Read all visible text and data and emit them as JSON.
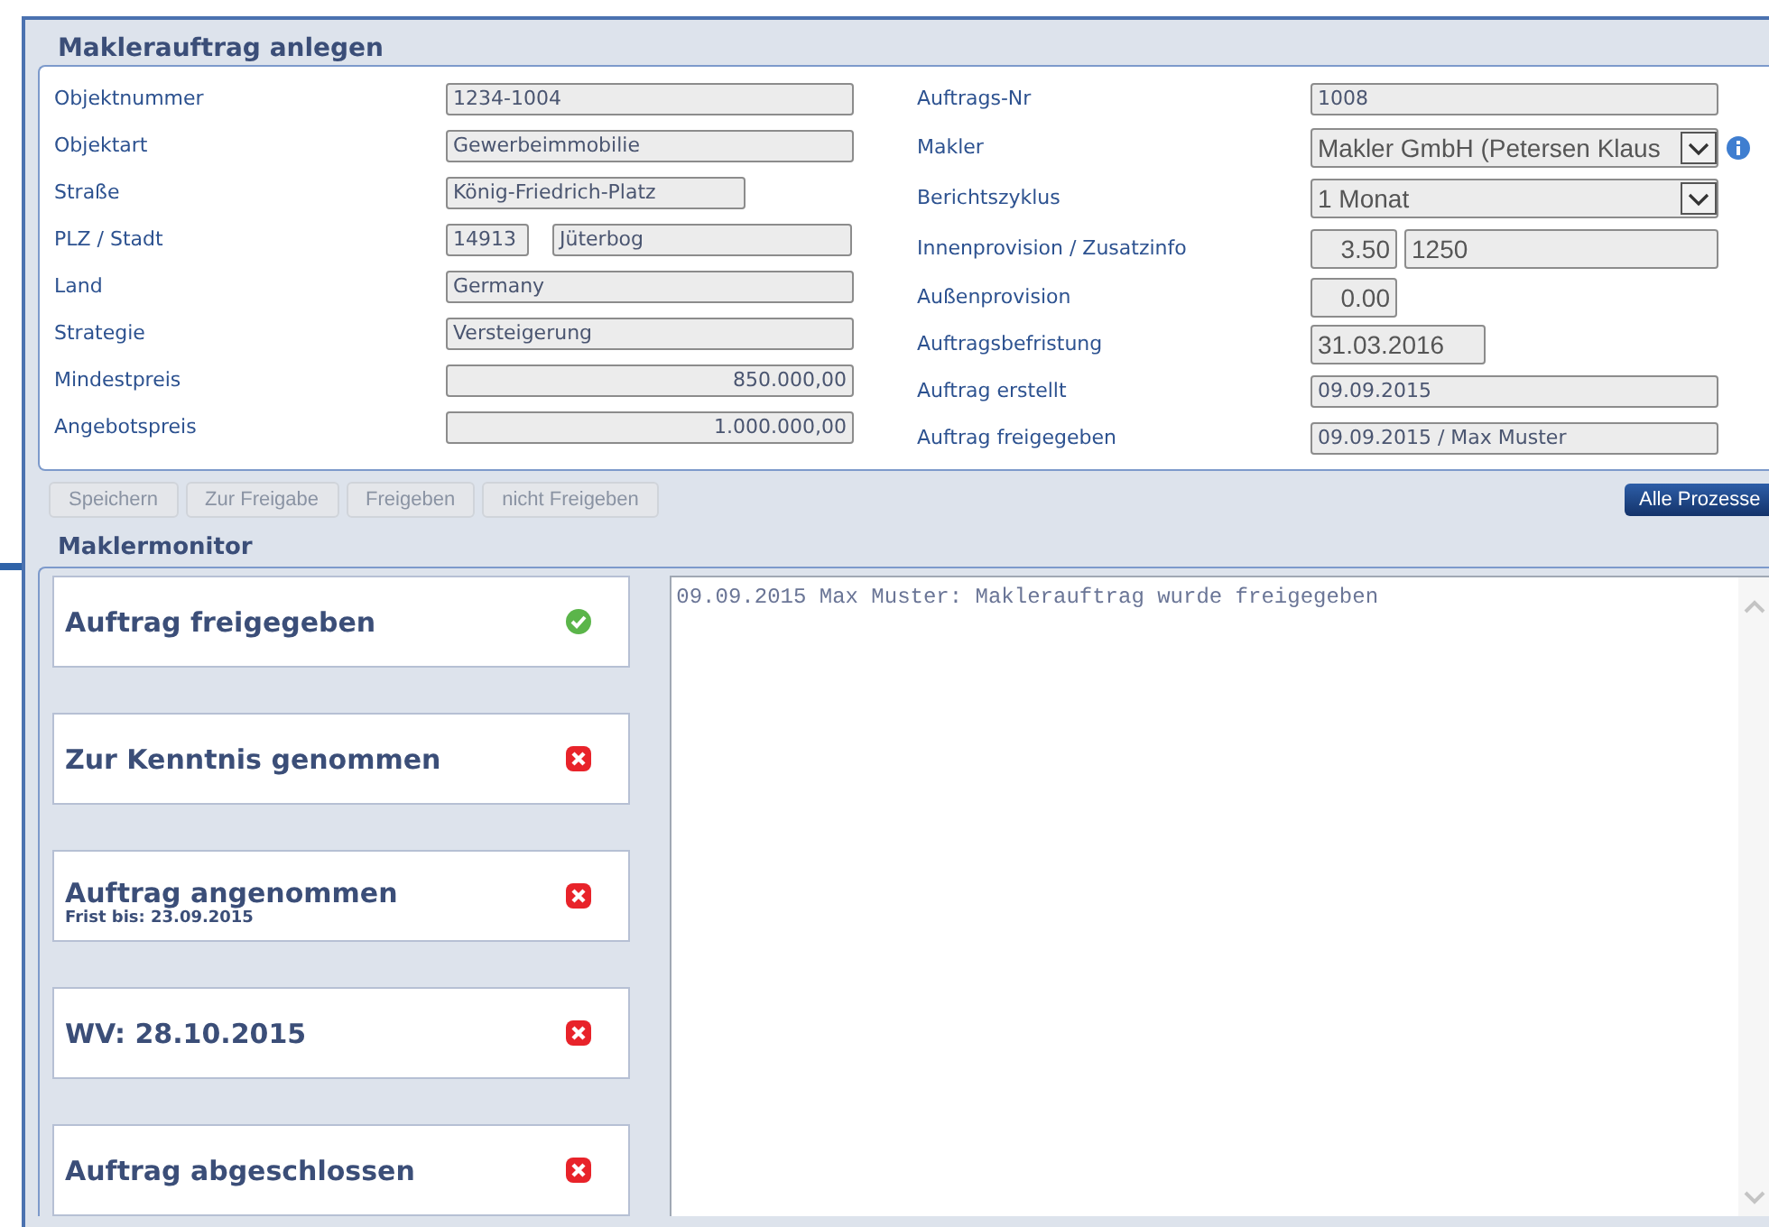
{
  "title": "Maklerauftrag anlegen",
  "left_fields": [
    {
      "label": "Objektnummer",
      "kind": "full",
      "values": [
        "1234-1004"
      ]
    },
    {
      "label": "Objektart",
      "kind": "full",
      "values": [
        "Gewerbeimmobilie"
      ]
    },
    {
      "label": "Straße",
      "kind": "medium",
      "values": [
        "König-Friedrich-Platz"
      ]
    },
    {
      "label": "PLZ / Stadt",
      "kind": "pair",
      "values": [
        "14913",
        "Jüterbog"
      ]
    },
    {
      "label": "Land",
      "kind": "full",
      "values": [
        "Germany"
      ]
    },
    {
      "label": "Strategie",
      "kind": "full",
      "values": [
        "Versteigerung"
      ]
    },
    {
      "label": "Mindestpreis",
      "kind": "amount",
      "values": [
        "850.000,00"
      ]
    },
    {
      "label": "Angebotspreis",
      "kind": "amount",
      "values": [
        "1.000.000,00"
      ]
    }
  ],
  "right_fields": [
    {
      "label": "Auftrags-Nr",
      "kind": "full",
      "values": [
        "1008"
      ]
    },
    {
      "label": "Makler",
      "kind": "select",
      "values": [
        "Makler GmbH (Petersen Klaus"
      ],
      "info": true
    },
    {
      "label": "Berichtszyklus",
      "kind": "select",
      "values": [
        "1 Monat"
      ],
      "info": false
    },
    {
      "label": "Innenprovision / Zusatzinfo",
      "kind": "numpair",
      "values": [
        "3.50",
        "1250"
      ]
    },
    {
      "label": "Außenprovision",
      "kind": "number",
      "values": [
        "0.00"
      ]
    },
    {
      "label": "Auftragsbefristung",
      "kind": "date",
      "values": [
        "31.03.2016"
      ]
    },
    {
      "label": "Auftrag erstellt",
      "kind": "full",
      "values": [
        "09.09.2015"
      ]
    },
    {
      "label": "Auftrag freigegeben",
      "kind": "full",
      "values": [
        "09.09.2015 / Max Muster"
      ]
    }
  ],
  "buttons": [
    {
      "label": "Speichern",
      "disabled": true
    },
    {
      "label": "Zur Freigabe",
      "disabled": true
    },
    {
      "label": "Freigeben",
      "disabled": true
    },
    {
      "label": "nicht Freigeben",
      "disabled": true
    }
  ],
  "process_button": {
    "label": "Alle Prozesse"
  },
  "monitor": {
    "title": "Maklermonitor",
    "steps": [
      {
        "title": "Auftrag freigegeben",
        "done": true
      },
      {
        "title": "Zur Kenntnis genommen",
        "done": false
      },
      {
        "title": "Auftrag angenommen",
        "subtitle": "Frist bis: 23.09.2015",
        "done": false
      },
      {
        "title": "WV: 28.10.2015",
        "done": false
      },
      {
        "title": "Auftrag abgeschlossen",
        "done": false
      }
    ],
    "log": "09.09.2015 Max Muster: Maklerauftrag wurde freigegeben"
  }
}
